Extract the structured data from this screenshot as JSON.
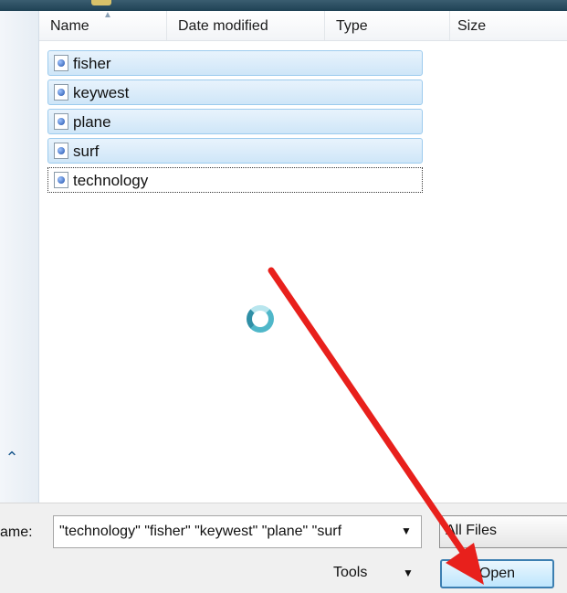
{
  "columns": {
    "name": "Name",
    "date_modified": "Date modified",
    "type": "Type",
    "size": "Size"
  },
  "files": [
    {
      "name": "fisher"
    },
    {
      "name": "keywest"
    },
    {
      "name": "plane"
    },
    {
      "name": "surf"
    },
    {
      "name": "technology"
    }
  ],
  "bottom": {
    "filename_label": "ame:",
    "filename_value": "\"technology\" \"fisher\" \"keywest\" \"plane\" \"surf",
    "filetype_value": "All Files",
    "tools_label": "Tools",
    "open_label": "Open"
  },
  "icons": {
    "file": "image-file-icon",
    "dropdown": "chevron-down-icon",
    "collapse": "chevron-up-icon",
    "busy": "spinner-icon"
  },
  "colors": {
    "selection": "#cfe6f8",
    "selection_border": "#9ccbee",
    "annotation_arrow": "#e8201c",
    "spinner": "#4fb7c9"
  }
}
